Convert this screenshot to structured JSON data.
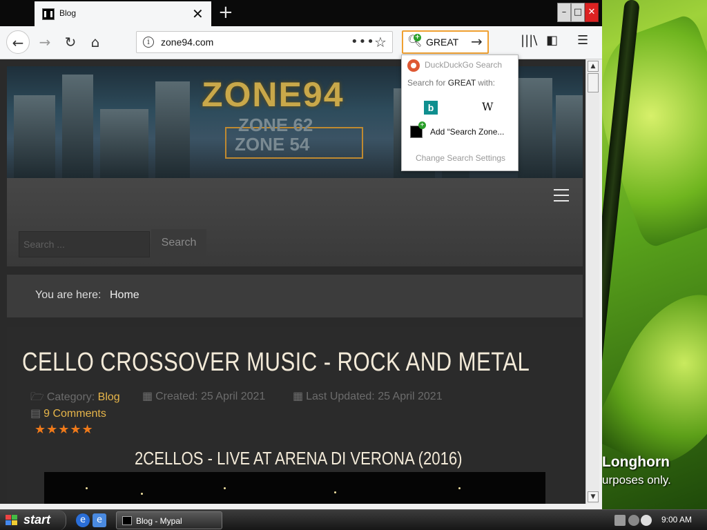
{
  "desktop": {
    "watermark_line1": "Longhorn",
    "watermark_line2": "urposes only."
  },
  "browser": {
    "tab": {
      "title": "Blog"
    },
    "window_controls": {
      "minimize": "–",
      "maximize": "□",
      "close": "✕"
    },
    "url": "zone94.com",
    "url_more": "•••",
    "search": {
      "query": "GREAT"
    },
    "dropdown": {
      "engine_name": "DuckDuckGo Search",
      "search_for_prefix": "Search for ",
      "search_for_term": "GREAT",
      "search_for_suffix": " with:",
      "bing_icon": "b",
      "wiki_icon": "W",
      "add_engine": "Add “Search Zone...",
      "change_settings": "Change Search Settings"
    }
  },
  "page": {
    "banner": {
      "logo": "ZONE94",
      "sub1": "ZONE 62",
      "sub2": "ZONE 54"
    },
    "site_search": {
      "placeholder": "Search ...",
      "button": "Search"
    },
    "breadcrumb": {
      "label": "You are here:",
      "home": "Home"
    },
    "article": {
      "title": "CELLO CROSSOVER MUSIC - ROCK AND METAL",
      "category_label": "Category: ",
      "category": "Blog",
      "created": "Created: 25 April 2021",
      "updated": "Last Updated: 25 April 2021",
      "comments": "9 Comments",
      "stars": "★★★★★",
      "rating": 5,
      "video_title": "2CELLOS - LIVE AT ARENA DI VERONA (2016)"
    }
  },
  "taskbar": {
    "start": "start",
    "task_window": "Blog - Mypal",
    "clock": "9:00 AM"
  },
  "colors": {
    "accent_link": "#e8b64a",
    "search_focus": "#f0a030",
    "stars": "#f07a1a"
  }
}
